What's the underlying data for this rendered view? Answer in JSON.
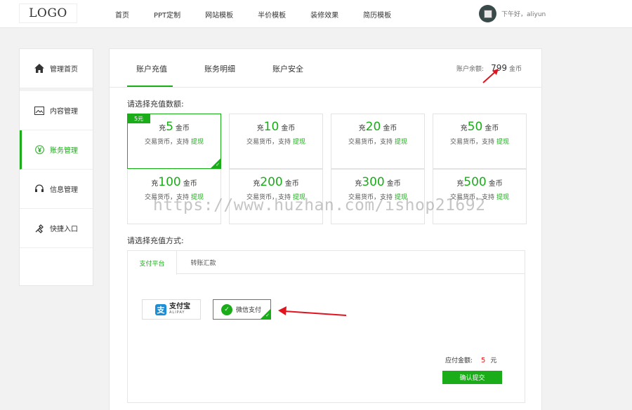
{
  "header": {
    "logo": "LOGO",
    "nav": [
      "首页",
      "PPT定制",
      "网站模板",
      "半价模板",
      "装修效果",
      "简历模板"
    ],
    "greeting": "下午好，aliyun"
  },
  "sidebar": {
    "items": [
      {
        "label": "管理首页",
        "icon": "home-icon"
      },
      {
        "label": "内容管理",
        "icon": "image-icon"
      },
      {
        "label": "账务管理",
        "icon": "yen-icon"
      },
      {
        "label": "信息管理",
        "icon": "headset-icon"
      },
      {
        "label": "快捷入口",
        "icon": "tools-icon"
      }
    ],
    "active_index": 2
  },
  "tabs": [
    "账户充值",
    "账务明细",
    "账户安全"
  ],
  "balance": {
    "label": "账户余额:",
    "value": "799",
    "unit": "金币"
  },
  "amount_section_label": "请选择充值数额:",
  "amounts": [
    {
      "prefix": "充",
      "num": "5",
      "unit": "金币",
      "desc": "交易货币，支持",
      "link": "提现",
      "selected": true,
      "badge": "5元"
    },
    {
      "prefix": "充",
      "num": "10",
      "unit": "金币",
      "desc": "交易货币，支持",
      "link": "提现",
      "selected": false
    },
    {
      "prefix": "充",
      "num": "20",
      "unit": "金币",
      "desc": "交易货币，支持",
      "link": "提现",
      "selected": false
    },
    {
      "prefix": "充",
      "num": "50",
      "unit": "金币",
      "desc": "交易货币，支持",
      "link": "提现",
      "selected": false
    },
    {
      "prefix": "充",
      "num": "100",
      "unit": "金币",
      "desc": "交易货币，支持",
      "link": "提现",
      "selected": false
    },
    {
      "prefix": "充",
      "num": "200",
      "unit": "金币",
      "desc": "交易货币，支持",
      "link": "提现",
      "selected": false
    },
    {
      "prefix": "充",
      "num": "300",
      "unit": "金币",
      "desc": "交易货币，支持",
      "link": "提现",
      "selected": false
    },
    {
      "prefix": "充",
      "num": "500",
      "unit": "金币",
      "desc": "交易货币，支持",
      "link": "提现",
      "selected": false
    }
  ],
  "method_section_label": "请选择充值方式:",
  "pay_tabs": [
    "支付平台",
    "转账汇款"
  ],
  "methods": {
    "alipay": {
      "cn": "支付宝",
      "en": "ALIPAY"
    },
    "wechat": {
      "label": "微信支付"
    }
  },
  "due": {
    "label": "应付金额:",
    "amount": "5",
    "unit": "元"
  },
  "submit_label": "确认提交",
  "watermark": "https://www.huzhan.com/ishop21692",
  "colors": {
    "accent": "#1aad19",
    "arrow": "#e0141e",
    "due": "#e02020"
  }
}
